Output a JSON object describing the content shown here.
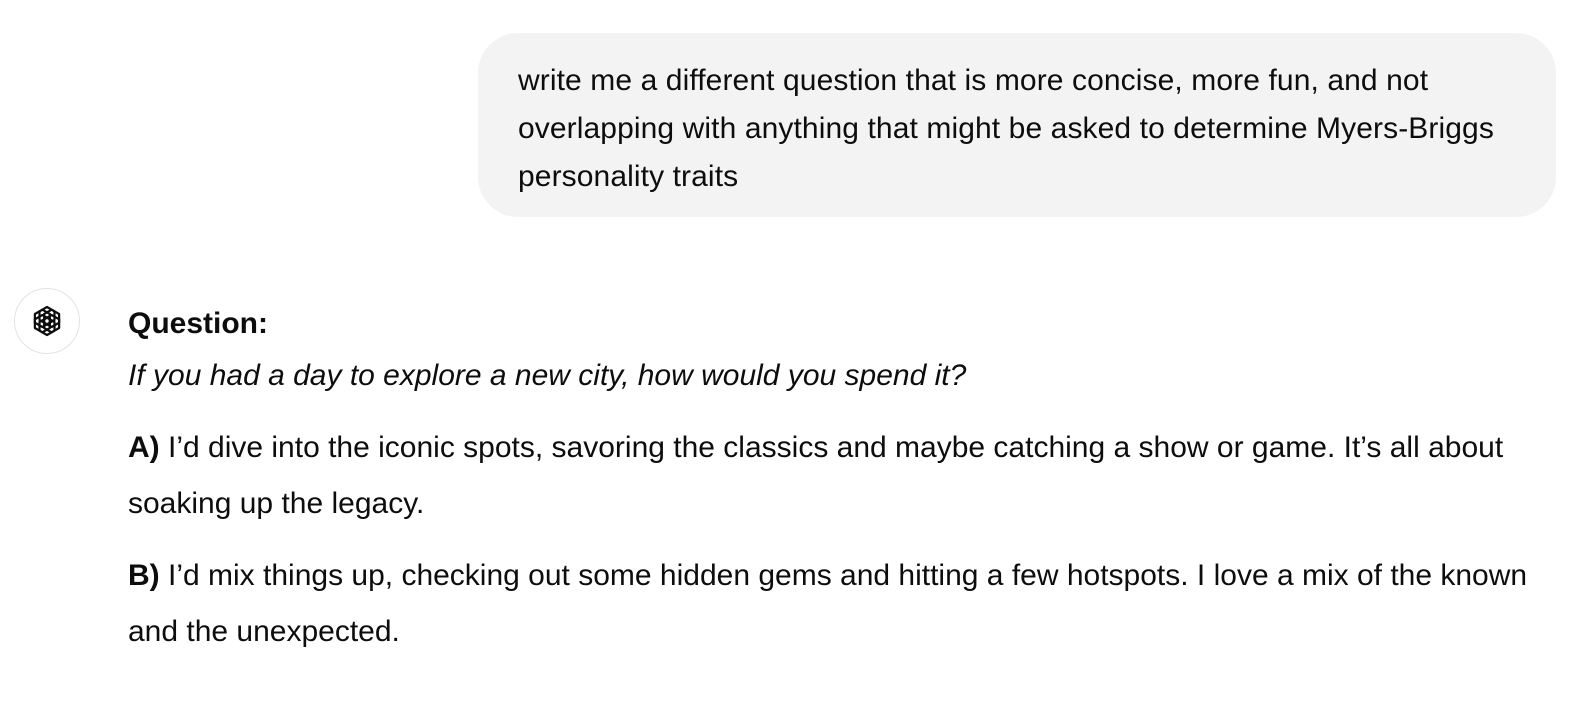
{
  "user_message": {
    "text": "write me a different question that is more concise, more fun, and not overlapping with anything that might be asked to determine Myers-Briggs personality traits"
  },
  "assistant": {
    "avatar_icon": "openai-logo-icon",
    "heading": "Question:",
    "question": "If you had a day to explore a new city, how would you spend it?",
    "options": [
      {
        "key": "A)",
        "text": "I’d dive into the iconic spots, savoring the classics and maybe catching a show or game. It’s all about soaking up the legacy."
      },
      {
        "key": "B)",
        "text": "I’d mix things up, checking out some hidden gems and hitting a few hotspots. I love a mix of the known and the unexpected."
      }
    ]
  },
  "colors": {
    "user_bubble_bg": "#f3f3f3",
    "text": "#0d0d0d",
    "avatar_border": "#e3e3e3"
  }
}
